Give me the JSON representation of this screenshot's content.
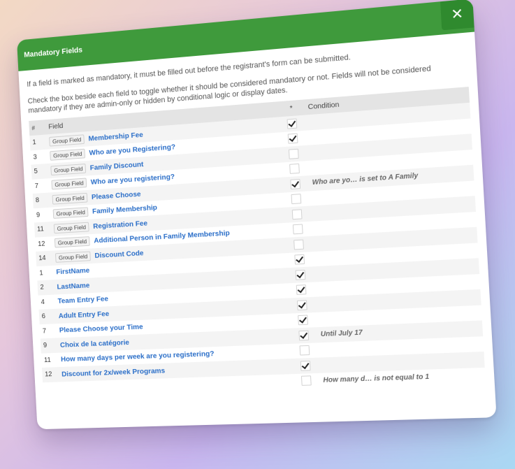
{
  "modal": {
    "title": "Mandatory Fields",
    "close_label": "✕",
    "intro": "If a field is marked as mandatory, it must be filled out before the registrant's form can be submitted.",
    "instructions": "Check the box beside each field to toggle whether it should be considered mandatory or not. Fields will not be considered mandatory if they are admin-only or hidden by conditional logic or display dates."
  },
  "table": {
    "headers": {
      "num": "#",
      "field": "Field",
      "mandatory": "*",
      "condition": "Condition"
    },
    "rows": [
      {
        "num": "1",
        "badge": "Group Field",
        "field": "Membership Fee",
        "checked": true,
        "condition": ""
      },
      {
        "num": "3",
        "badge": "Group Field",
        "field": "Who are you Registering?",
        "checked": true,
        "condition": ""
      },
      {
        "num": "5",
        "badge": "Group Field",
        "field": "Family Discount",
        "checked": false,
        "condition": ""
      },
      {
        "num": "7",
        "badge": "Group Field",
        "field": "Who are you registering?",
        "checked": false,
        "condition": ""
      },
      {
        "num": "8",
        "badge": "Group Field",
        "field": "Please Choose",
        "checked": true,
        "condition": "Who are yo… is set to A Family"
      },
      {
        "num": "9",
        "badge": "Group Field",
        "field": "Family Membership",
        "checked": false,
        "condition": ""
      },
      {
        "num": "11",
        "badge": "Group Field",
        "field": "Registration Fee",
        "checked": false,
        "condition": ""
      },
      {
        "num": "12",
        "badge": "Group Field",
        "field": "Additional Person in Family Membership",
        "checked": false,
        "condition": ""
      },
      {
        "num": "14",
        "badge": "Group Field",
        "field": "Discount Code",
        "checked": false,
        "condition": ""
      },
      {
        "num": "1",
        "badge": "",
        "field": "FirstName",
        "checked": true,
        "condition": ""
      },
      {
        "num": "2",
        "badge": "",
        "field": "LastName",
        "checked": true,
        "condition": ""
      },
      {
        "num": "4",
        "badge": "",
        "field": "Team Entry Fee",
        "checked": true,
        "condition": ""
      },
      {
        "num": "6",
        "badge": "",
        "field": "Adult Entry Fee",
        "checked": true,
        "condition": ""
      },
      {
        "num": "7",
        "badge": "",
        "field": "Please Choose your Time",
        "checked": true,
        "condition": ""
      },
      {
        "num": "9",
        "badge": "",
        "field": "Choix de la catégorie",
        "checked": true,
        "condition": "Until July 17"
      },
      {
        "num": "11",
        "badge": "",
        "field": "How many days per week are you registering?",
        "checked": false,
        "condition": ""
      },
      {
        "num": "12",
        "badge": "",
        "field": "Discount for 2x/week Programs",
        "checked": true,
        "condition": ""
      },
      {
        "num": "",
        "badge": "",
        "field": "",
        "checked": false,
        "condition": "How many d… is not equal to 1"
      }
    ]
  }
}
